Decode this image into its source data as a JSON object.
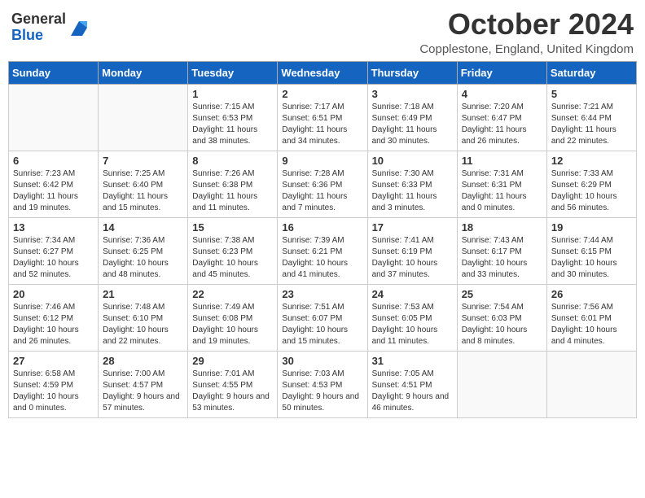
{
  "logo": {
    "general": "General",
    "blue": "Blue"
  },
  "header": {
    "month": "October 2024",
    "location": "Copplestone, England, United Kingdom"
  },
  "weekdays": [
    "Sunday",
    "Monday",
    "Tuesday",
    "Wednesday",
    "Thursday",
    "Friday",
    "Saturday"
  ],
  "weeks": [
    [
      {
        "day": "",
        "detail": ""
      },
      {
        "day": "",
        "detail": ""
      },
      {
        "day": "1",
        "detail": "Sunrise: 7:15 AM\nSunset: 6:53 PM\nDaylight: 11 hours\nand 38 minutes."
      },
      {
        "day": "2",
        "detail": "Sunrise: 7:17 AM\nSunset: 6:51 PM\nDaylight: 11 hours\nand 34 minutes."
      },
      {
        "day": "3",
        "detail": "Sunrise: 7:18 AM\nSunset: 6:49 PM\nDaylight: 11 hours\nand 30 minutes."
      },
      {
        "day": "4",
        "detail": "Sunrise: 7:20 AM\nSunset: 6:47 PM\nDaylight: 11 hours\nand 26 minutes."
      },
      {
        "day": "5",
        "detail": "Sunrise: 7:21 AM\nSunset: 6:44 PM\nDaylight: 11 hours\nand 22 minutes."
      }
    ],
    [
      {
        "day": "6",
        "detail": "Sunrise: 7:23 AM\nSunset: 6:42 PM\nDaylight: 11 hours\nand 19 minutes."
      },
      {
        "day": "7",
        "detail": "Sunrise: 7:25 AM\nSunset: 6:40 PM\nDaylight: 11 hours\nand 15 minutes."
      },
      {
        "day": "8",
        "detail": "Sunrise: 7:26 AM\nSunset: 6:38 PM\nDaylight: 11 hours\nand 11 minutes."
      },
      {
        "day": "9",
        "detail": "Sunrise: 7:28 AM\nSunset: 6:36 PM\nDaylight: 11 hours\nand 7 minutes."
      },
      {
        "day": "10",
        "detail": "Sunrise: 7:30 AM\nSunset: 6:33 PM\nDaylight: 11 hours\nand 3 minutes."
      },
      {
        "day": "11",
        "detail": "Sunrise: 7:31 AM\nSunset: 6:31 PM\nDaylight: 11 hours\nand 0 minutes."
      },
      {
        "day": "12",
        "detail": "Sunrise: 7:33 AM\nSunset: 6:29 PM\nDaylight: 10 hours\nand 56 minutes."
      }
    ],
    [
      {
        "day": "13",
        "detail": "Sunrise: 7:34 AM\nSunset: 6:27 PM\nDaylight: 10 hours\nand 52 minutes."
      },
      {
        "day": "14",
        "detail": "Sunrise: 7:36 AM\nSunset: 6:25 PM\nDaylight: 10 hours\nand 48 minutes."
      },
      {
        "day": "15",
        "detail": "Sunrise: 7:38 AM\nSunset: 6:23 PM\nDaylight: 10 hours\nand 45 minutes."
      },
      {
        "day": "16",
        "detail": "Sunrise: 7:39 AM\nSunset: 6:21 PM\nDaylight: 10 hours\nand 41 minutes."
      },
      {
        "day": "17",
        "detail": "Sunrise: 7:41 AM\nSunset: 6:19 PM\nDaylight: 10 hours\nand 37 minutes."
      },
      {
        "day": "18",
        "detail": "Sunrise: 7:43 AM\nSunset: 6:17 PM\nDaylight: 10 hours\nand 33 minutes."
      },
      {
        "day": "19",
        "detail": "Sunrise: 7:44 AM\nSunset: 6:15 PM\nDaylight: 10 hours\nand 30 minutes."
      }
    ],
    [
      {
        "day": "20",
        "detail": "Sunrise: 7:46 AM\nSunset: 6:12 PM\nDaylight: 10 hours\nand 26 minutes."
      },
      {
        "day": "21",
        "detail": "Sunrise: 7:48 AM\nSunset: 6:10 PM\nDaylight: 10 hours\nand 22 minutes."
      },
      {
        "day": "22",
        "detail": "Sunrise: 7:49 AM\nSunset: 6:08 PM\nDaylight: 10 hours\nand 19 minutes."
      },
      {
        "day": "23",
        "detail": "Sunrise: 7:51 AM\nSunset: 6:07 PM\nDaylight: 10 hours\nand 15 minutes."
      },
      {
        "day": "24",
        "detail": "Sunrise: 7:53 AM\nSunset: 6:05 PM\nDaylight: 10 hours\nand 11 minutes."
      },
      {
        "day": "25",
        "detail": "Sunrise: 7:54 AM\nSunset: 6:03 PM\nDaylight: 10 hours\nand 8 minutes."
      },
      {
        "day": "26",
        "detail": "Sunrise: 7:56 AM\nSunset: 6:01 PM\nDaylight: 10 hours\nand 4 minutes."
      }
    ],
    [
      {
        "day": "27",
        "detail": "Sunrise: 6:58 AM\nSunset: 4:59 PM\nDaylight: 10 hours\nand 0 minutes."
      },
      {
        "day": "28",
        "detail": "Sunrise: 7:00 AM\nSunset: 4:57 PM\nDaylight: 9 hours\nand 57 minutes."
      },
      {
        "day": "29",
        "detail": "Sunrise: 7:01 AM\nSunset: 4:55 PM\nDaylight: 9 hours\nand 53 minutes."
      },
      {
        "day": "30",
        "detail": "Sunrise: 7:03 AM\nSunset: 4:53 PM\nDaylight: 9 hours\nand 50 minutes."
      },
      {
        "day": "31",
        "detail": "Sunrise: 7:05 AM\nSunset: 4:51 PM\nDaylight: 9 hours\nand 46 minutes."
      },
      {
        "day": "",
        "detail": ""
      },
      {
        "day": "",
        "detail": ""
      }
    ]
  ]
}
